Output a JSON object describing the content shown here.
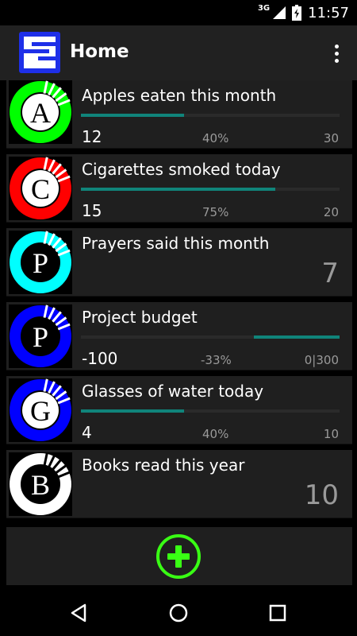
{
  "status": {
    "network": "3G",
    "time": "11:57"
  },
  "app": {
    "title": "Home"
  },
  "items": [
    {
      "letter": "A",
      "color": "#00ff00",
      "title": "Apples eaten this month",
      "current": "12",
      "percent": "40%",
      "max": "30",
      "progress": 0.4
    },
    {
      "letter": "C",
      "color": "#ff0000",
      "title": "Cigarettes smoked today",
      "current": "15",
      "percent": "75%",
      "max": "20",
      "progress": 0.75
    },
    {
      "letter": "P",
      "color": "#00ffff",
      "title": "Prayers said this month",
      "value": "7"
    },
    {
      "letter": "P",
      "color": "#0000ff",
      "title": "Project budget",
      "current": "-100",
      "percent": "-33%",
      "max": "0|300",
      "progress": -0.33
    },
    {
      "letter": "G",
      "color": "#0000ff",
      "title": "Glasses of water today",
      "current": "4",
      "percent": "40%",
      "max": "10",
      "progress": 0.4
    },
    {
      "letter": "B",
      "color": "#ffffff",
      "title": "Books read this year",
      "value": "10"
    }
  ],
  "fab": {
    "icon": "plus-icon",
    "color": "#39ff14"
  },
  "nav": {
    "back_icon": "back-icon",
    "home_icon": "home-icon",
    "recents_icon": "recents-icon"
  }
}
